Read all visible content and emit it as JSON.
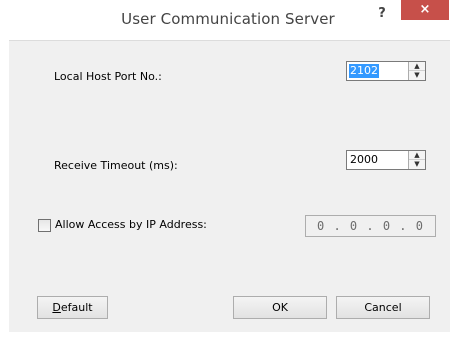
{
  "window": {
    "title": "User Communication Server",
    "help_glyph": "?",
    "close_glyph": "×"
  },
  "fields": {
    "port_label": "Local Host Port No.:",
    "port_value": "2102",
    "timeout_label": "Receive Timeout (ms):",
    "timeout_value": "2000",
    "allow_ip_label": "Allow Access by IP Address:",
    "allow_ip_checked": false,
    "ip_value": "0 . 0 . 0 . 0"
  },
  "buttons": {
    "default_mnemonic": "D",
    "default_rest": "efault",
    "ok_label": "OK",
    "cancel_label": "Cancel"
  },
  "icons": {
    "spin_up": "up-arrow-icon",
    "spin_down": "down-arrow-icon"
  },
  "colors": {
    "close_button": "#c7504a",
    "selection": "#3399ff",
    "client_background": "#f0f0f0"
  }
}
